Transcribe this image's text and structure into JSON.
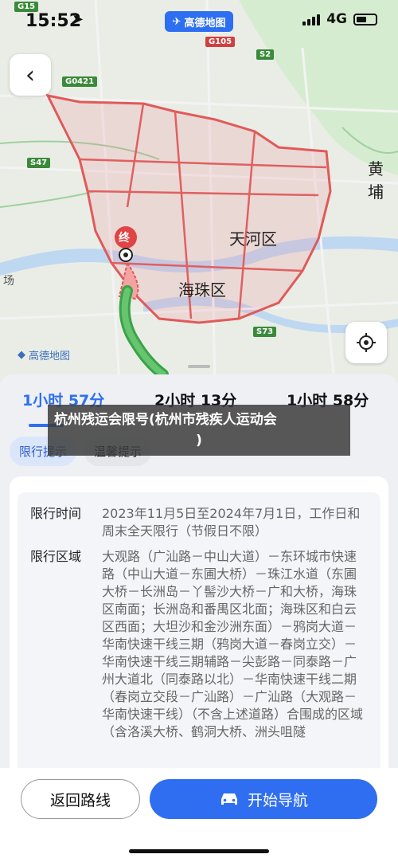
{
  "status": {
    "time": "15:52",
    "network": "4G"
  },
  "map": {
    "brand_label": "高德地图",
    "watermark": "高德地图",
    "road_signs": [
      "G15",
      "G105",
      "S2",
      "G0421",
      "S47",
      "S73"
    ],
    "labels": [
      "天河区",
      "海珠区",
      "黄埔",
      "场"
    ],
    "destination_marker": "终"
  },
  "routes": {
    "tabs": [
      "1小时 57分",
      "2小时 13分",
      "1小时 58分"
    ],
    "active_index": 0
  },
  "banner": {
    "line1": "杭州残运会限号(杭州市残疾人运动会",
    "line2": ")"
  },
  "chips": [
    "限行提示",
    "温馨提示"
  ],
  "restriction": {
    "time_label": "限行时间",
    "time_value": "2023年11月5日至2024年7月1日，工作日和周末全天限行（节假日不限）",
    "area_label": "限行区域",
    "area_value": "大观路（广汕路－中山大道）－东环城市快速路（中山大道－东圃大桥）－珠江水道（东圃大桥－长洲岛－丫髻沙大桥－广和大桥，海珠区南面；长洲岛和番禺区北面；海珠区和白云区西面；大坦沙和金沙洲东面）－鸦岗大道－华南快速干线三期（鸦岗大道－春岗立交）－华南快速干线三期辅路－尖彭路－同泰路－广州大道北（同泰路以北）－华南快速干线二期（春岗立交段－广汕路）－广汕路（大观路－华南快速干线）（不含上述道路）合围成的区域（含洛溪大桥、鹤洞大桥、洲头咀隧"
  },
  "actions": {
    "back_label": "返回路线",
    "start_label": "开始导航"
  }
}
